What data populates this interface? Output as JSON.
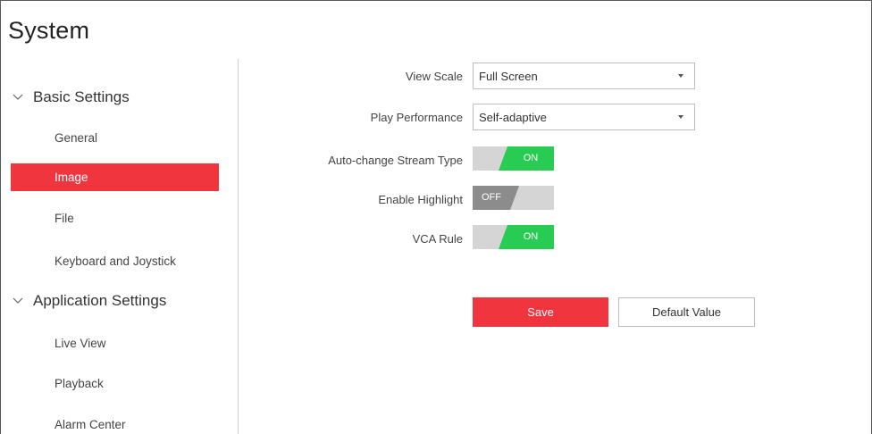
{
  "page": {
    "title": "System"
  },
  "sidebar": {
    "groups": [
      {
        "label": "Basic Settings",
        "icon": "chevron-down-icon",
        "items": [
          {
            "label": "General"
          },
          {
            "label": "Image"
          },
          {
            "label": "File"
          },
          {
            "label": "Keyboard and Joystick"
          }
        ]
      },
      {
        "label": "Application Settings",
        "icon": "chevron-down-icon",
        "items": [
          {
            "label": "Live View"
          },
          {
            "label": "Playback"
          },
          {
            "label": "Alarm Center"
          }
        ]
      }
    ],
    "active_item": "Image"
  },
  "form": {
    "view_scale": {
      "label": "View Scale",
      "value": "Full Screen"
    },
    "play_performance": {
      "label": "Play Performance",
      "value": "Self-adaptive"
    },
    "auto_change_stream": {
      "label": "Auto-change Stream Type",
      "state": "ON"
    },
    "enable_highlight": {
      "label": "Enable Highlight",
      "state": "OFF"
    },
    "vca_rule": {
      "label": "VCA Rule",
      "state": "ON"
    }
  },
  "buttons": {
    "save": "Save",
    "default": "Default Value"
  },
  "colors": {
    "accent": "#f0353f",
    "toggle_on": "#29cc52",
    "toggle_off": "#8c8c8c"
  }
}
